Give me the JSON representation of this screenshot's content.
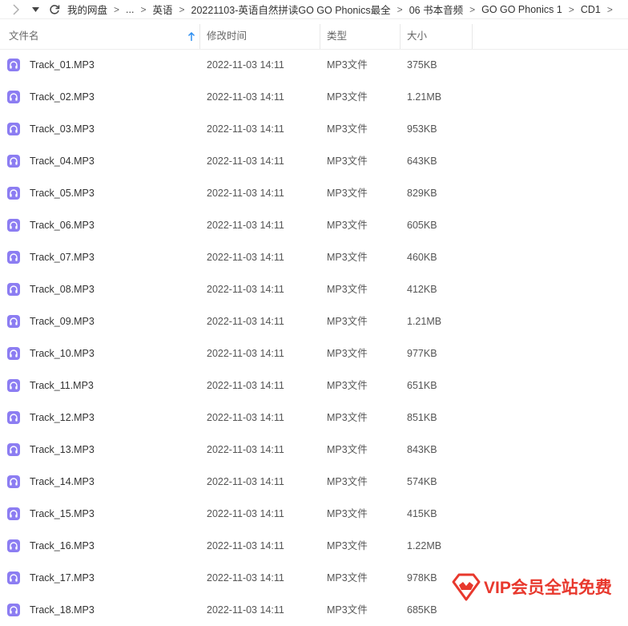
{
  "breadcrumb": {
    "items": [
      "我的网盘",
      "...",
      "英语",
      "20221103-英语自然拼读GO GO Phonics最全",
      "06 书本音频",
      "GO GO Phonics 1",
      "CD1"
    ],
    "separator": ">"
  },
  "columns": {
    "name": "文件名",
    "modified": "修改时间",
    "type": "类型",
    "size": "大小"
  },
  "files": [
    {
      "name": "Track_01.MP3",
      "modified": "2022-11-03 14:11",
      "type": "MP3文件",
      "size": "375KB"
    },
    {
      "name": "Track_02.MP3",
      "modified": "2022-11-03 14:11",
      "type": "MP3文件",
      "size": "1.21MB"
    },
    {
      "name": "Track_03.MP3",
      "modified": "2022-11-03 14:11",
      "type": "MP3文件",
      "size": "953KB"
    },
    {
      "name": "Track_04.MP3",
      "modified": "2022-11-03 14:11",
      "type": "MP3文件",
      "size": "643KB"
    },
    {
      "name": "Track_05.MP3",
      "modified": "2022-11-03 14:11",
      "type": "MP3文件",
      "size": "829KB"
    },
    {
      "name": "Track_06.MP3",
      "modified": "2022-11-03 14:11",
      "type": "MP3文件",
      "size": "605KB"
    },
    {
      "name": "Track_07.MP3",
      "modified": "2022-11-03 14:11",
      "type": "MP3文件",
      "size": "460KB"
    },
    {
      "name": "Track_08.MP3",
      "modified": "2022-11-03 14:11",
      "type": "MP3文件",
      "size": "412KB"
    },
    {
      "name": "Track_09.MP3",
      "modified": "2022-11-03 14:11",
      "type": "MP3文件",
      "size": "1.21MB"
    },
    {
      "name": "Track_10.MP3",
      "modified": "2022-11-03 14:11",
      "type": "MP3文件",
      "size": "977KB"
    },
    {
      "name": "Track_11.MP3",
      "modified": "2022-11-03 14:11",
      "type": "MP3文件",
      "size": "651KB"
    },
    {
      "name": "Track_12.MP3",
      "modified": "2022-11-03 14:11",
      "type": "MP3文件",
      "size": "851KB"
    },
    {
      "name": "Track_13.MP3",
      "modified": "2022-11-03 14:11",
      "type": "MP3文件",
      "size": "843KB"
    },
    {
      "name": "Track_14.MP3",
      "modified": "2022-11-03 14:11",
      "type": "MP3文件",
      "size": "574KB"
    },
    {
      "name": "Track_15.MP3",
      "modified": "2022-11-03 14:11",
      "type": "MP3文件",
      "size": "415KB"
    },
    {
      "name": "Track_16.MP3",
      "modified": "2022-11-03 14:11",
      "type": "MP3文件",
      "size": "1.22MB"
    },
    {
      "name": "Track_17.MP3",
      "modified": "2022-11-03 14:11",
      "type": "MP3文件",
      "size": "978KB"
    },
    {
      "name": "Track_18.MP3",
      "modified": "2022-11-03 14:11",
      "type": "MP3文件",
      "size": "685KB"
    }
  ],
  "watermark": {
    "text": "VIP会员全站免费"
  },
  "icons": {
    "forward": "chevron-right-icon",
    "dropdown": "caret-down-icon",
    "refresh": "refresh-icon",
    "sort": "sort-ascending-icon",
    "file": "audio-file-icon"
  },
  "colors": {
    "audio_icon": "#8c7df2",
    "sort_arrow": "#2f8ff0",
    "watermark": "#e8382d"
  },
  "sort": {
    "column": "name",
    "direction": "ascending"
  }
}
